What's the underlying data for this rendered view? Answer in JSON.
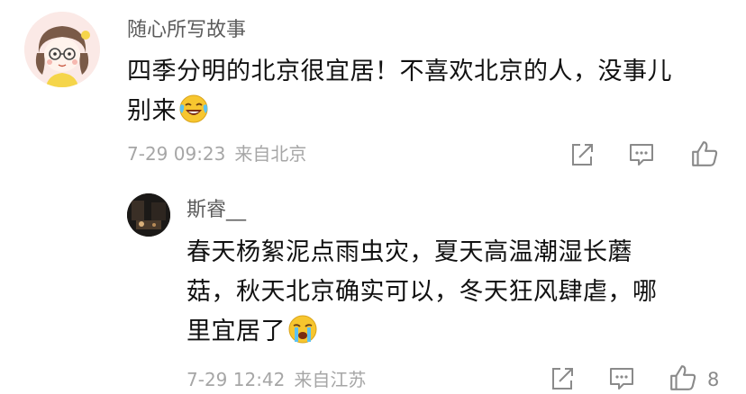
{
  "comment": {
    "username": "随心所写故事",
    "content_lines": [
      "四季分明的北京很宜居！不喜欢北京的人，没事儿",
      "别来"
    ],
    "emoji": "laughing-crying-emoji",
    "time": "7-29 09:23",
    "location": "来自北京",
    "actions": {
      "share_icon": "share-icon",
      "comment_icon": "comment-icon",
      "like_icon": "thumbs-up-icon"
    }
  },
  "reply": {
    "username": "斯睿__",
    "content_lines": [
      "春天杨絮泥点雨虫灾，夏天高温潮湿长蘑",
      "菇，秋天北京确实可以，冬天狂风肆虐，哪",
      "里宜居了"
    ],
    "emoji": "loudly-crying-emoji",
    "time": "7-29 12:42",
    "location": "来自江苏",
    "like_count": "8",
    "actions": {
      "share_icon": "share-icon",
      "comment_icon": "comment-icon",
      "like_icon": "thumbs-up-icon"
    }
  },
  "colors": {
    "text": "#111111",
    "username": "#5b5b5b",
    "meta": "#a6a6a6",
    "icon": "#8a8a8a",
    "emoji_face": "#f7c62f"
  }
}
